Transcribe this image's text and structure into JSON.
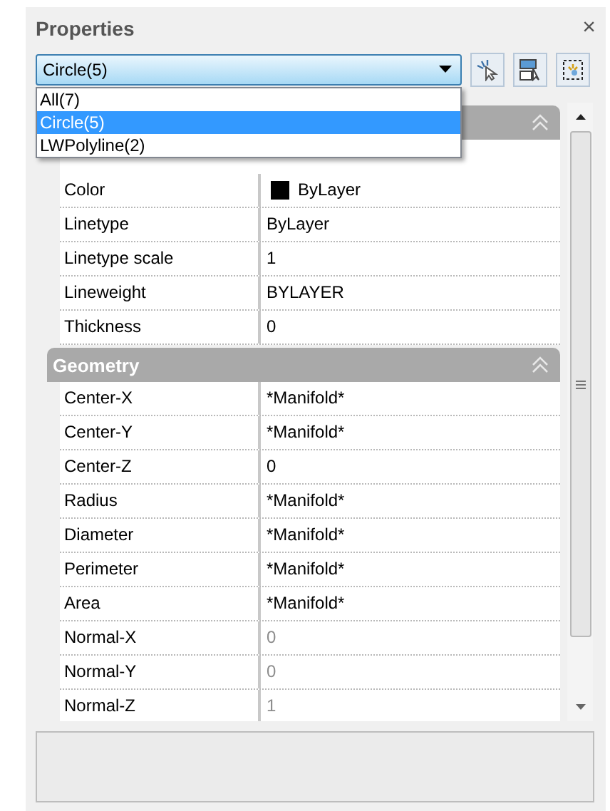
{
  "panel": {
    "title": "Properties",
    "close": "×"
  },
  "selector": {
    "value": "Circle(5)",
    "options": [
      {
        "label": "All(7)",
        "selected": false
      },
      {
        "label": "Circle(5)",
        "selected": true
      },
      {
        "label": "LWPolyline(2)",
        "selected": false
      }
    ]
  },
  "sections": [
    {
      "expanded": true,
      "rows": [
        {
          "label": "Color",
          "value": "ByLayer",
          "kind": "swatch",
          "color": "#000000",
          "disabled": false
        },
        {
          "label": "Linetype",
          "value": "ByLayer",
          "kind": "text",
          "disabled": false
        },
        {
          "label": "Linetype scale",
          "value": "1",
          "kind": "text",
          "disabled": false
        },
        {
          "label": "Lineweight",
          "value": "BYLAYER",
          "kind": "text",
          "disabled": false
        },
        {
          "label": "Thickness",
          "value": "0",
          "kind": "text",
          "disabled": false
        }
      ]
    },
    {
      "title": "Geometry",
      "expanded": true,
      "rows": [
        {
          "label": "Center-X",
          "value": "*Manifold*",
          "kind": "text",
          "disabled": false
        },
        {
          "label": "Center-Y",
          "value": "*Manifold*",
          "kind": "text",
          "disabled": false
        },
        {
          "label": "Center-Z",
          "value": "0",
          "kind": "text",
          "disabled": false
        },
        {
          "label": "Radius",
          "value": "*Manifold*",
          "kind": "text",
          "disabled": false
        },
        {
          "label": "Diameter",
          "value": "*Manifold*",
          "kind": "text",
          "disabled": false
        },
        {
          "label": "Perimeter",
          "value": "*Manifold*",
          "kind": "text",
          "disabled": false
        },
        {
          "label": "Area",
          "value": "*Manifold*",
          "kind": "text",
          "disabled": false
        },
        {
          "label": "Normal-X",
          "value": "0",
          "kind": "text",
          "disabled": true
        },
        {
          "label": "Normal-Y",
          "value": "0",
          "kind": "text",
          "disabled": true
        },
        {
          "label": "Normal-Z",
          "value": "1",
          "kind": "text",
          "disabled": true
        }
      ]
    }
  ]
}
